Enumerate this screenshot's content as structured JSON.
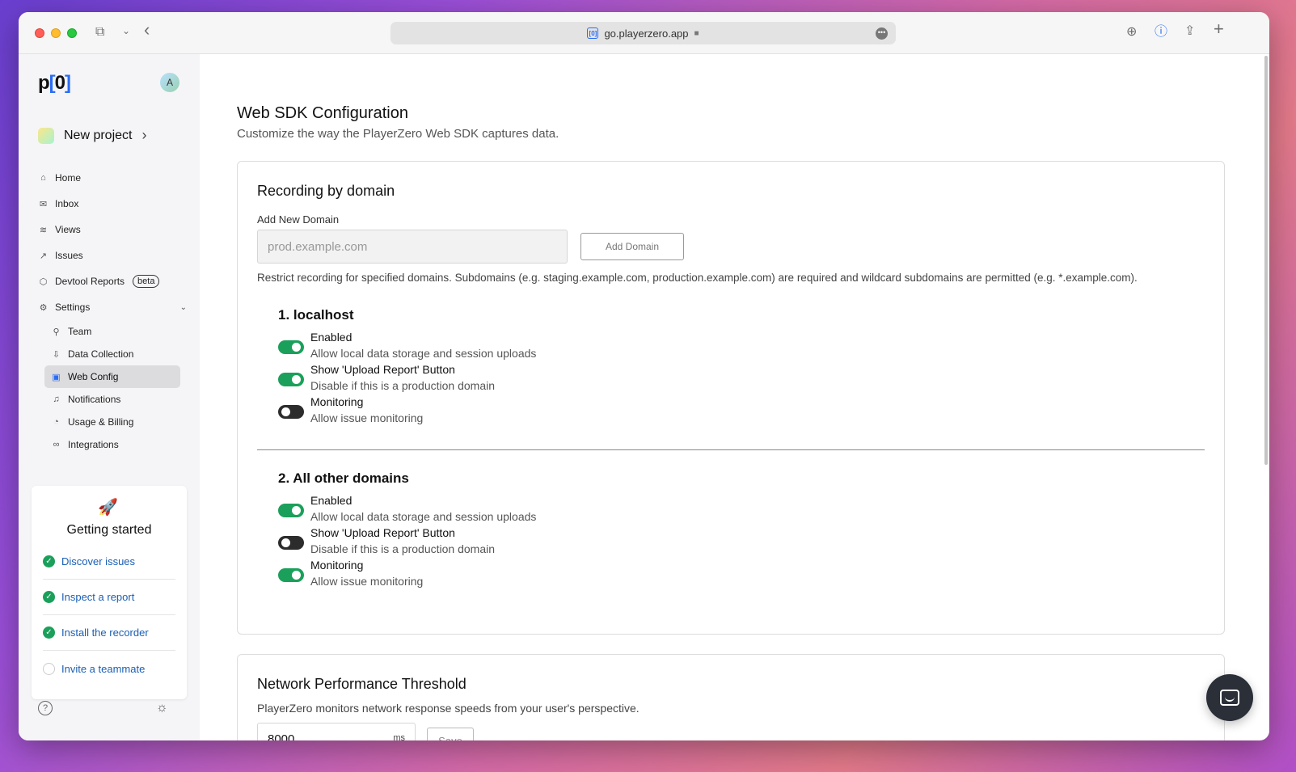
{
  "browser": {
    "url": "go.playerzero.app",
    "favicon_glyph": "[0]",
    "buttons": {
      "sidebar_toggle_glyph": "⧉",
      "dropdown_glyph": "⌄",
      "back_glyph": "‹",
      "download_glyph": "⊕",
      "password_glyph": "ⓘ",
      "share_glyph": "⇪",
      "new_tab_glyph": "+"
    }
  },
  "sidebar": {
    "logo": {
      "p": "p",
      "open": "[",
      "zero": "0",
      "close": "]"
    },
    "avatar_initial": "A",
    "project_name": "New project",
    "project_chevron": "›",
    "nav": {
      "home": {
        "label": "Home",
        "icon": "⌂"
      },
      "inbox": {
        "label": "Inbox",
        "icon": "✉"
      },
      "views": {
        "label": "Views",
        "icon": "≋"
      },
      "issues": {
        "label": "Issues",
        "icon": "↗"
      },
      "devtool": {
        "label": "Devtool Reports",
        "icon": "⬡",
        "badge": "beta"
      },
      "settings": {
        "label": "Settings",
        "icon": "⚙",
        "chevron": "⌄"
      },
      "team": {
        "label": "Team",
        "icon": "⚲"
      },
      "data_collection": {
        "label": "Data Collection",
        "icon": "⇩"
      },
      "web_config": {
        "label": "Web Config",
        "icon": "▣"
      },
      "notifications": {
        "label": "Notifications",
        "icon": "♫"
      },
      "usage_billing": {
        "label": "Usage & Billing",
        "icon": "◔"
      },
      "integrations": {
        "label": "Integrations",
        "icon": "∞"
      }
    },
    "getting_started": {
      "icon": "🚀",
      "title": "Getting started",
      "items": [
        {
          "label": "Discover issues",
          "done": true
        },
        {
          "label": "Inspect a report",
          "done": true
        },
        {
          "label": "Install the recorder",
          "done": true
        },
        {
          "label": "Invite a teammate",
          "done": false
        }
      ]
    },
    "help_glyph": "?",
    "theme_glyph": "☼"
  },
  "main": {
    "title": "Web SDK Configuration",
    "subtitle": "Customize the way the PlayerZero Web SDK captures data.",
    "recording": {
      "title": "Recording by domain",
      "field_label": "Add New Domain",
      "placeholder": "prod.example.com",
      "add_button": "Add Domain",
      "help": "Restrict recording for specified domains. Subdomains (e.g. staging.example.com, production.example.com) are required and wildcard subdomains are permitted (e.g. *.example.com).",
      "domains": [
        {
          "title": "1. localhost",
          "toggles": [
            {
              "label": "Enabled",
              "desc": "Allow local data storage and session uploads",
              "on": true
            },
            {
              "label": "Show 'Upload Report' Button",
              "desc": "Disable if this is a production domain",
              "on": true
            },
            {
              "label": "Monitoring",
              "desc": "Allow issue monitoring",
              "on": false
            }
          ]
        },
        {
          "title": "2. All other domains",
          "toggles": [
            {
              "label": "Enabled",
              "desc": "Allow local data storage and session uploads",
              "on": true
            },
            {
              "label": "Show 'Upload Report' Button",
              "desc": "Disable if this is a production domain",
              "on": false
            },
            {
              "label": "Monitoring",
              "desc": "Allow issue monitoring",
              "on": true
            }
          ]
        }
      ]
    },
    "network": {
      "title": "Network Performance Threshold",
      "subtitle": "PlayerZero monitors network response speeds from your user's perspective.",
      "value": "8000",
      "unit": "ms",
      "save_button": "Save"
    }
  },
  "colors": {
    "toggle_on": "#1aa05a",
    "toggle_off": "#2c2c2c",
    "link": "#1a5fb4",
    "active_nav": "#dcdcde"
  }
}
